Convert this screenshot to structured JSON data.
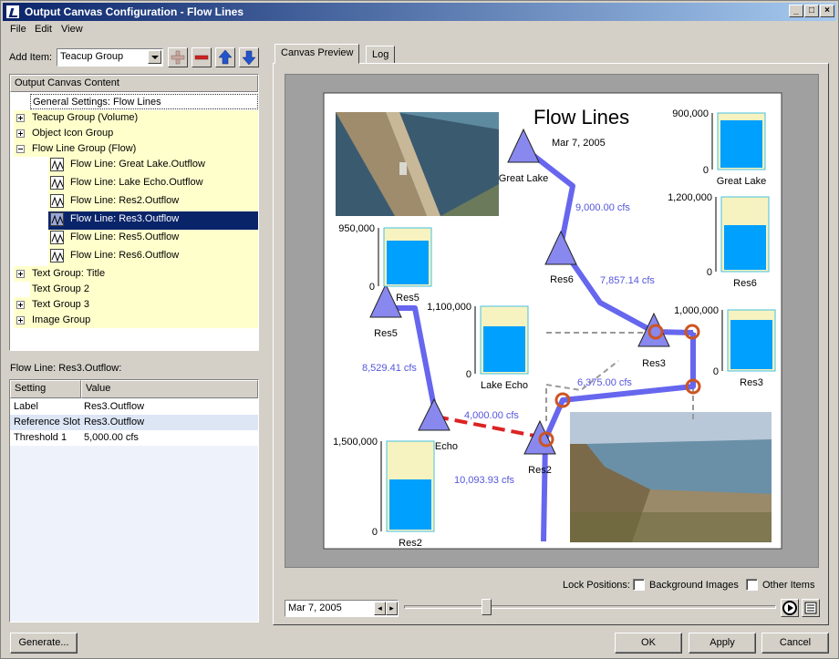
{
  "window": {
    "title": "Output Canvas Configuration - Flow Lines"
  },
  "menu": {
    "file": "File",
    "edit": "Edit",
    "view": "View"
  },
  "add_item": {
    "label": "Add Item:",
    "value": "Teacup Group"
  },
  "tree": {
    "header": "Output Canvas Content",
    "items": [
      {
        "label": "General Settings: Flow Lines"
      },
      {
        "label": "Teacup Group (Volume)"
      },
      {
        "label": "Object Icon Group"
      },
      {
        "label": "Flow Line Group (Flow)"
      },
      {
        "label": "Flow Line: Great Lake.Outflow"
      },
      {
        "label": "Flow Line: Lake Echo.Outflow"
      },
      {
        "label": "Flow Line: Res2.Outflow"
      },
      {
        "label": "Flow Line: Res3.Outflow"
      },
      {
        "label": "Flow Line: Res5.Outflow"
      },
      {
        "label": "Flow Line: Res6.Outflow"
      },
      {
        "label": "Text Group: Title"
      },
      {
        "label": "Text Group 2"
      },
      {
        "label": "Text Group 3"
      },
      {
        "label": "Image Group"
      }
    ]
  },
  "props": {
    "title": "Flow Line: Res3.Outflow:",
    "col_setting": "Setting",
    "col_value": "Value",
    "rows": [
      {
        "setting": "Label",
        "value": "Res3.Outflow"
      },
      {
        "setting": "Reference Slot",
        "value": "Res3.Outflow"
      },
      {
        "setting": "Threshold 1",
        "value": "5,000.00 cfs"
      }
    ]
  },
  "tabs": {
    "preview": "Canvas Preview",
    "log": "Log"
  },
  "canvas": {
    "title": "Flow Lines",
    "date": "Mar 7, 2005",
    "nodes": {
      "great_lake": "Great Lake",
      "res6": "Res6",
      "res5": "Res5",
      "res3": "Res3",
      "lake_echo": "Lake Echo",
      "res2": "Res2"
    },
    "flows": {
      "f1": "9,000.00 cfs",
      "f2": "7,857.14 cfs",
      "f3": "8,529.41 cfs",
      "f4": "6,375.00 cfs",
      "f5": "4,000.00 cfs",
      "f6": "10,093.93 cfs"
    },
    "teacups": [
      {
        "name": "Great Lake",
        "max": "900,000",
        "min": "0",
        "fill": 0.89
      },
      {
        "name": "Res6",
        "max": "1,200,000",
        "min": "0",
        "fill": 0.63
      },
      {
        "name": "Res5",
        "max": "950,000",
        "min": "0",
        "fill": 0.8
      },
      {
        "name": "Lake Echo",
        "max": "1,100,000",
        "min": "0",
        "fill": 0.71
      },
      {
        "name": "Res3",
        "max": "1,000,000",
        "min": "0",
        "fill": 0.86
      },
      {
        "name": "Res2",
        "max": "1,500,000",
        "min": "0",
        "fill": 0.58
      }
    ]
  },
  "footer": {
    "lock_label": "Lock Positions:",
    "bg_images": "Background Images",
    "other_items": "Other Items",
    "date_value": "Mar 7, 2005",
    "slider_position": 0.22
  },
  "buttons": {
    "generate": "Generate...",
    "ok": "OK",
    "apply": "Apply",
    "cancel": "Cancel"
  },
  "colors": {
    "flow_line": "#6666ee",
    "flow_alert": "#dd2222",
    "teacup_fill": "#00a0ff",
    "teacup_empty": "#f7f3c0",
    "node": "#8888ee",
    "threshold_circle": "#cc5522",
    "selection": "#0a246a"
  }
}
